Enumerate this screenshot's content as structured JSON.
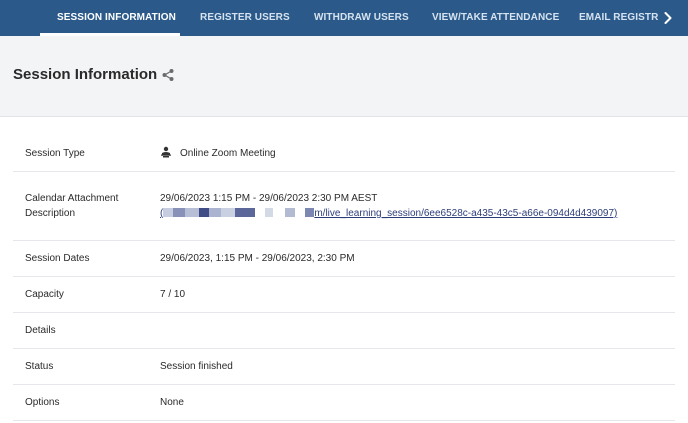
{
  "tabs": [
    {
      "label": "SESSION INFORMATION",
      "active": true
    },
    {
      "label": "REGISTER USERS",
      "active": false
    },
    {
      "label": "WITHDRAW USERS",
      "active": false
    },
    {
      "label": "VIEW/TAKE ATTENDANCE",
      "active": false
    },
    {
      "label": "EMAIL REGISTR",
      "active": false
    }
  ],
  "header": {
    "title": "Session Information"
  },
  "session": {
    "type_label": "Session Type",
    "type_value": "Online Zoom Meeting",
    "calendar_label_line1": "Calendar Attachment",
    "calendar_label_line2": "Description",
    "calendar_value_line1": "29/06/2023 1:15 PM - 29/06/2023 2:30 PM AEST",
    "calendar_link_prefix": "(",
    "calendar_link_suffix": "m/live_learning_session/6ee6528c-a435-43c5-a66e-094d4d439097)",
    "dates_label": "Session Dates",
    "dates_value": "29/06/2023, 1:15 PM - 29/06/2023, 2:30 PM",
    "capacity_label": "Capacity",
    "capacity_value": "7 / 10",
    "details_label": "Details",
    "details_value": "",
    "status_label": "Status",
    "status_value": "Session finished",
    "options_label": "Options",
    "options_value": "None"
  },
  "colors": {
    "tabbar": "#2b5a8a",
    "header_bg": "#f3f4f6",
    "link": "#2c3e7a"
  },
  "icons": {
    "zoom": "zoom-meeting-icon",
    "share": "share-icon",
    "chevron": "chevron-right-icon"
  }
}
